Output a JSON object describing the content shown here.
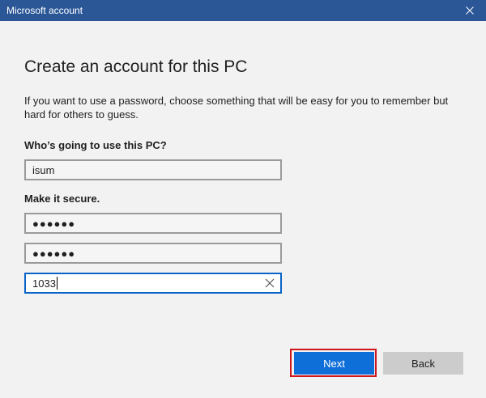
{
  "window": {
    "title": "Microsoft account"
  },
  "page": {
    "heading": "Create an account for this PC",
    "description": "If you want to use a password, choose something that will be easy for you to remember but hard for others to guess."
  },
  "form": {
    "who_label": "Who’s going to use this PC?",
    "username_value": "isum",
    "secure_label": "Make it secure.",
    "password_value": "●●●●●●",
    "confirm_password_value": "●●●●●●",
    "hint_value": "1033"
  },
  "buttons": {
    "next_label": "Next",
    "back_label": "Back"
  },
  "colors": {
    "titlebar": "#2b5797",
    "accent": "#0f6fd8",
    "highlight": "#d0181c"
  }
}
